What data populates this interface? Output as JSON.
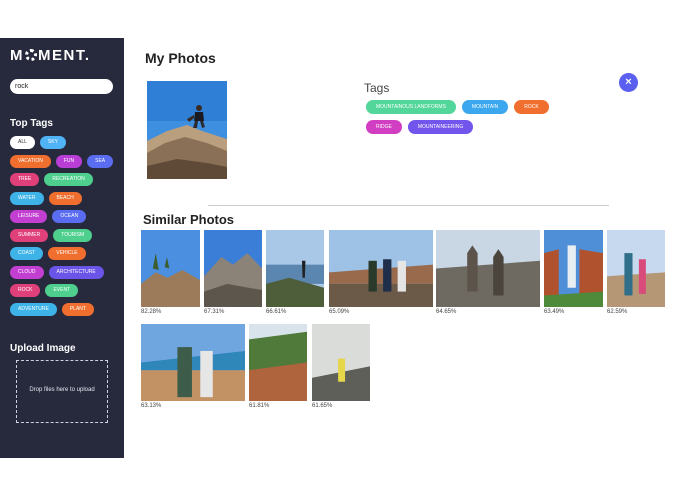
{
  "sidebar": {
    "logo_left": "M",
    "logo_right": "MENT.",
    "search_value": "rock",
    "top_tags_title": "Top Tags",
    "tags": [
      {
        "label": "ALL",
        "color": "#ffffff",
        "text_color": "#333333"
      },
      {
        "label": "SKY",
        "color": "#4fb3f6"
      },
      {
        "label": "VACATION",
        "color": "#f06f2e"
      },
      {
        "label": "FUN",
        "color": "#b93ed6"
      },
      {
        "label": "SEA",
        "color": "#5a6cf0"
      },
      {
        "label": "TREE",
        "color": "#e0407a"
      },
      {
        "label": "RECREATION",
        "color": "#4ecf8e"
      },
      {
        "label": "WATER",
        "color": "#3db3e8"
      },
      {
        "label": "BEACH",
        "color": "#f06f2e"
      },
      {
        "label": "LEISURE",
        "color": "#c23fd2"
      },
      {
        "label": "OCEAN",
        "color": "#5a6cf0"
      },
      {
        "label": "SUMMER",
        "color": "#e0407a"
      },
      {
        "label": "TOURISM",
        "color": "#4ecf8e"
      },
      {
        "label": "COAST",
        "color": "#3db3e8"
      },
      {
        "label": "VEHICLE",
        "color": "#f06f2e"
      },
      {
        "label": "CLOUD",
        "color": "#c23fd2"
      },
      {
        "label": "ARCHITECTURE",
        "color": "#6a55e8"
      },
      {
        "label": "ROCK",
        "color": "#e0407a"
      },
      {
        "label": "EVENT",
        "color": "#4ecf8e"
      },
      {
        "label": "ADVENTURE",
        "color": "#3db3e8"
      },
      {
        "label": "PLANT",
        "color": "#f06f2e"
      }
    ],
    "upload_title": "Upload Image",
    "dropzone_text": "Drop files here to upload"
  },
  "main": {
    "title": "My Photos",
    "tags_title": "Tags",
    "close_symbol": "×",
    "photo_tags": [
      {
        "label": "MOUNTAINOUS LANDFORMS",
        "color": "#52d69a"
      },
      {
        "label": "MOUNTAIN",
        "color": "#3ba7ee"
      },
      {
        "label": "ROCK",
        "color": "#f06f2e"
      },
      {
        "label": "RIDGE",
        "color": "#d13ec2"
      },
      {
        "label": "MOUNTAINEERING",
        "color": "#7155ec"
      }
    ],
    "similar_title": "Similar Photos",
    "similar": [
      {
        "score": "82.28%"
      },
      {
        "score": "67.31%"
      },
      {
        "score": "66.61%"
      },
      {
        "score": "65.09%"
      },
      {
        "score": "64.65%"
      },
      {
        "score": "63.49%"
      },
      {
        "score": "62.59%"
      },
      {
        "score": "63.13%"
      },
      {
        "score": "61.81%"
      },
      {
        "score": "61.65%"
      }
    ]
  }
}
